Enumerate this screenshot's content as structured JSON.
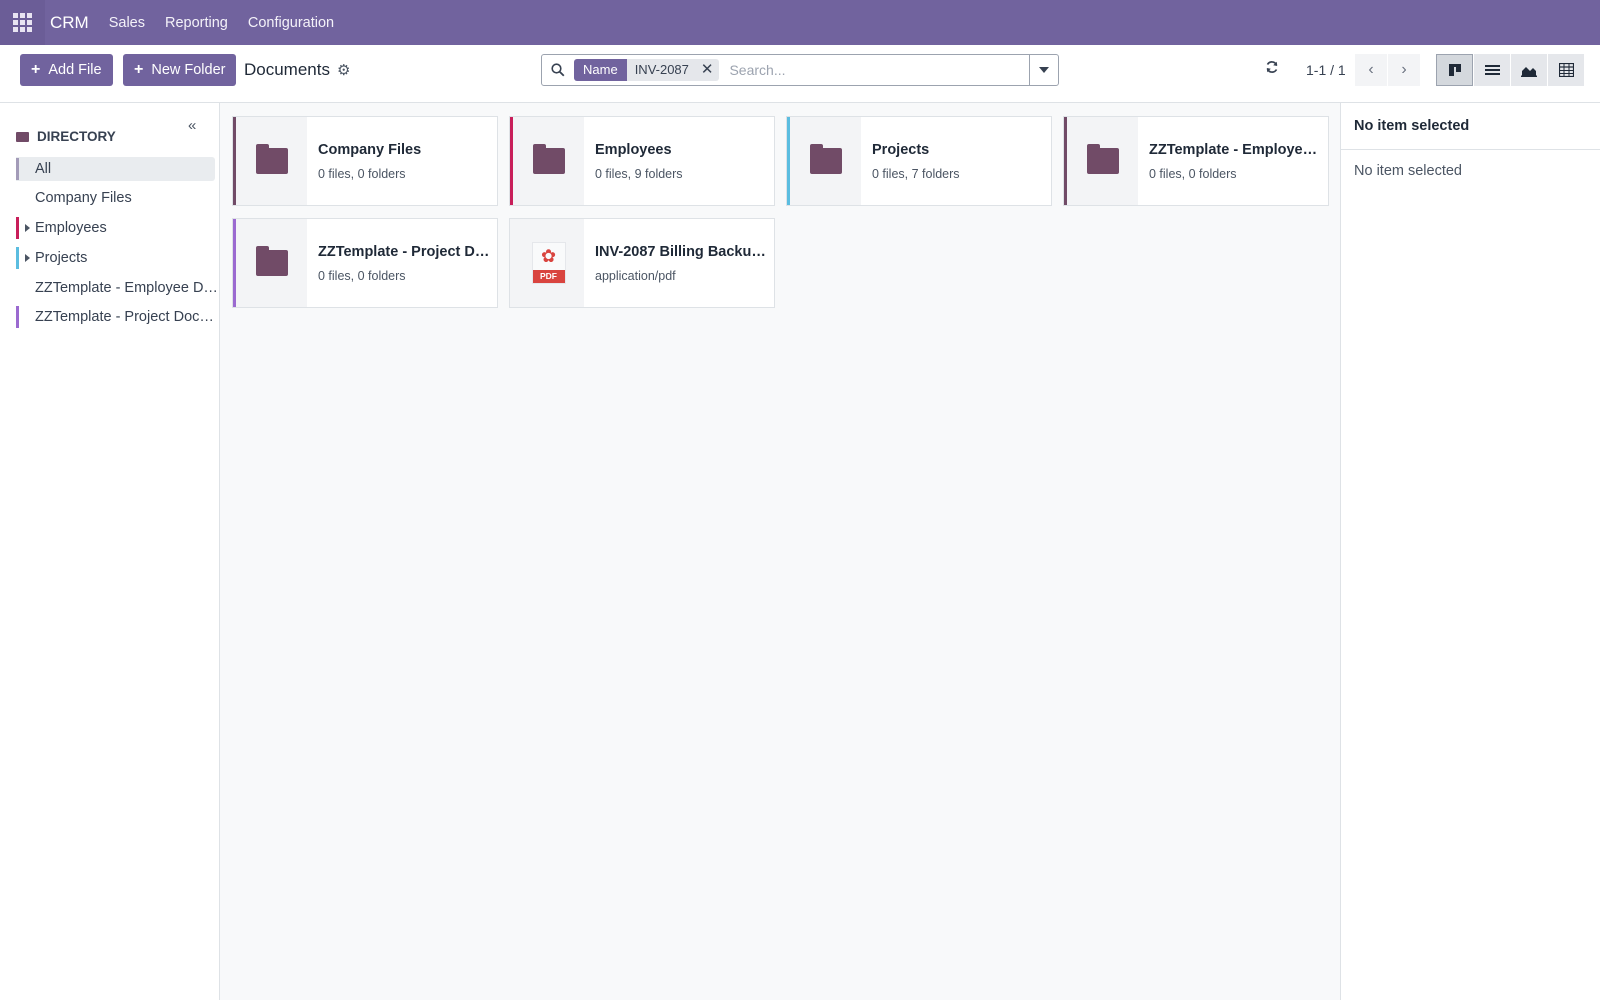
{
  "navbar": {
    "brand": "CRM",
    "menu": [
      "Sales",
      "Reporting",
      "Configuration"
    ],
    "color": "#71639e"
  },
  "control": {
    "add_file": "Add File",
    "new_folder": "New Folder",
    "title": "Documents",
    "search": {
      "facet_label": "Name",
      "facet_value": "INV-2087",
      "placeholder": "Search..."
    },
    "pager": "1-1 / 1",
    "views": [
      "kanban",
      "list",
      "graph",
      "pivot"
    ],
    "active_view": "kanban"
  },
  "sidebar": {
    "header": "DIRECTORY",
    "items": [
      {
        "label": "All",
        "color": "#a39bb8",
        "active": true
      },
      {
        "label": "Company Files",
        "color": "",
        "active": false
      },
      {
        "label": "Employees",
        "color": "#c81e5a",
        "has_children": true
      },
      {
        "label": "Projects",
        "color": "#5bbde0",
        "has_children": true
      },
      {
        "label": "ZZTemplate - Employee D…",
        "color": ""
      },
      {
        "label": "ZZTemplate - Project Doc…",
        "color": "#9b6ad0"
      }
    ]
  },
  "cards": [
    {
      "title": "Company Files",
      "sub": "0 files, 0 folders",
      "accent": "#714b67",
      "icon": "folder-icon"
    },
    {
      "title": "Employees",
      "sub": "0 files, 9 folders",
      "accent": "#c81e5a",
      "icon": "folder-icon"
    },
    {
      "title": "Projects",
      "sub": "0 files, 7 folders",
      "accent": "#5bbde0",
      "icon": "folder-icon"
    },
    {
      "title": "ZZTemplate - Employee…",
      "sub": "0 files, 0 folders",
      "accent": "#714b67",
      "icon": "folder-icon"
    },
    {
      "title": "ZZTemplate - Project D…",
      "sub": "0 files, 0 folders",
      "accent": "#9b6ad0",
      "icon": "folder-icon"
    },
    {
      "title": "INV-2087 Billing Backu…",
      "sub": "application/pdf",
      "accent": "",
      "icon": "pdf-icon",
      "pdf_label": "PDF"
    }
  ],
  "inspector": {
    "title": "No item selected",
    "subtitle": "No item selected"
  }
}
